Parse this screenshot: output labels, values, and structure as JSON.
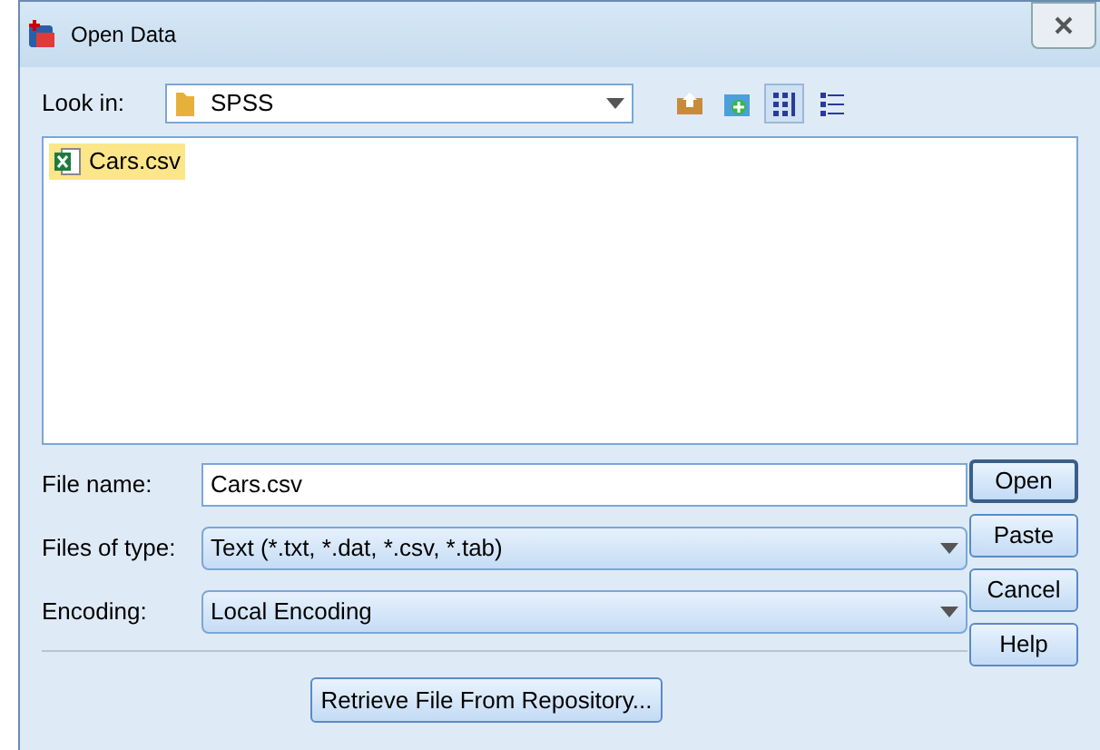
{
  "window": {
    "title": "Open Data"
  },
  "look_in": {
    "label": "Look in:",
    "value": "SPSS"
  },
  "view_buttons": [
    {
      "kind": "list",
      "selected": true
    },
    {
      "kind": "details",
      "selected": false
    }
  ],
  "files": [
    {
      "name": "Cars.csv",
      "selected": true
    }
  ],
  "fields": [
    {
      "kind": "text",
      "label": "File name:",
      "value": "Cars.csv"
    },
    {
      "kind": "dropdown",
      "label": "Files of type:",
      "value": "Text (*.txt, *.dat, *.csv, *.tab)"
    },
    {
      "kind": "dropdown",
      "label": "Encoding:",
      "value": "Local Encoding"
    }
  ],
  "buttons": [
    {
      "label": "Open",
      "default": true
    },
    {
      "label": "Paste",
      "default": false
    },
    {
      "label": "Cancel",
      "default": false
    },
    {
      "label": "Help",
      "default": false
    }
  ],
  "repository_button": "Retrieve File From Repository..."
}
